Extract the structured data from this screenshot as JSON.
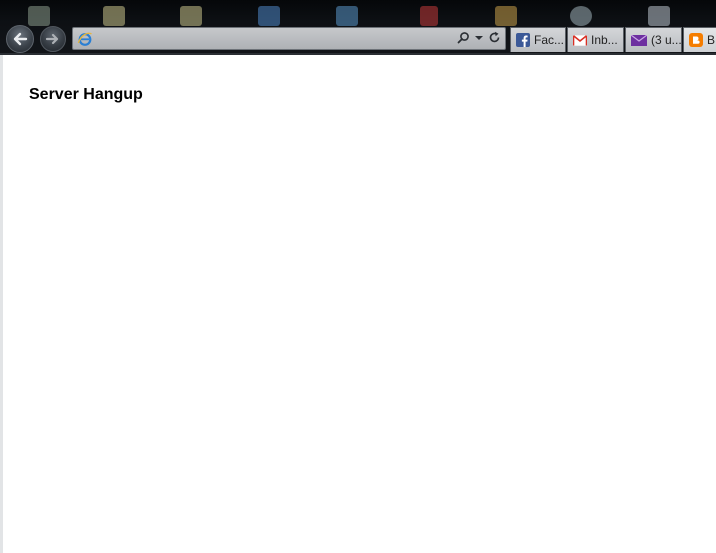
{
  "browser": {
    "address": {
      "value": "",
      "placeholder": ""
    },
    "tabs": [
      {
        "label": "Fac...",
        "icon": "facebook-icon",
        "color": "#3b5998"
      },
      {
        "label": "Inb...",
        "icon": "gmail-icon",
        "color": "#d93025"
      },
      {
        "label": "(3 u...",
        "icon": "yahoo-mail-icon",
        "color": "#6d2fa0"
      },
      {
        "label": "B",
        "icon": "blogger-icon",
        "color": "#f57d00"
      }
    ]
  },
  "page": {
    "heading": "Server Hangup"
  }
}
